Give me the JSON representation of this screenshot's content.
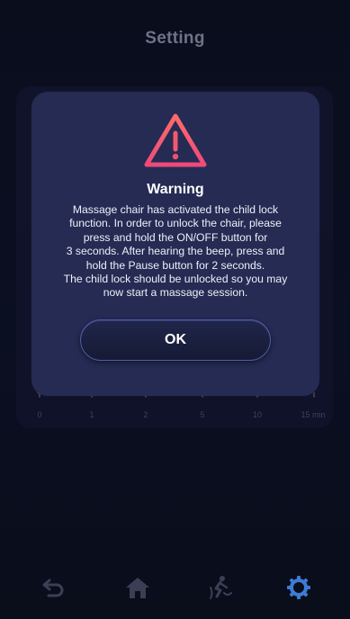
{
  "header": {
    "title": "Setting"
  },
  "timer_scale": {
    "labels": [
      "0",
      "1",
      "2",
      "5",
      "10",
      "15 min"
    ]
  },
  "dialog": {
    "title": "Warning",
    "body_lines": [
      "Massage chair has activated the child lock",
      "function. In order to unlock the chair, please",
      "press and hold the ON/OFF button for",
      "3 seconds. After hearing the beep, press and",
      "hold the Pause button for 2 seconds.",
      "The child lock should be unlocked so you may",
      "now start a massage session."
    ],
    "ok_label": "OK"
  },
  "nav": {
    "items": [
      {
        "icon": "back-icon"
      },
      {
        "icon": "home-icon"
      },
      {
        "icon": "massage-icon"
      },
      {
        "icon": "gear-icon",
        "active": true
      }
    ]
  },
  "colors": {
    "background": "#0b0e1d",
    "dialog": "#252b53",
    "warning": "#f0506e",
    "active_nav": "#3e7bd6",
    "inactive_nav": "#3b3f55"
  }
}
